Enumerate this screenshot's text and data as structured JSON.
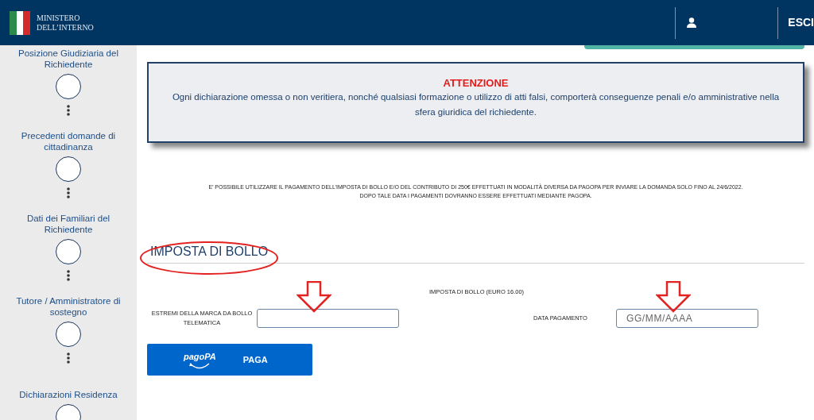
{
  "header": {
    "logo_lines": [
      "MINISTERO",
      "DELL’INTERNO"
    ],
    "logout": "ESCI"
  },
  "sidebar": {
    "steps": [
      {
        "label": "Posizione Giudiziaria del Richiedente"
      },
      {
        "label": "Precedenti domande di cittadinanza"
      },
      {
        "label": "Dati dei Familiari del Richiedente"
      },
      {
        "label": "Tutore / Amministratore di sostegno"
      },
      {
        "label": "Dichiarazioni Residenza"
      }
    ]
  },
  "alert": {
    "title": "ATTENZIONE",
    "text": "Ogni dichiarazione omessa o non veritiera, nonché qualsiasi formazione o utilizzo di atti falsi, comporterà conseguenze penali e/o amministrative nella sfera giuridica del richiedente."
  },
  "notice": [
    "E’ POSSIBILE UTILIZZARE IL PAGAMENTO DELL’IMPOSTA DI BOLLO E/O DEL CONTRIBUTO DI 250€ EFFETTUATI IN MODALITÀ DIVERSA DA PAGOPA PER INVIARE LA DOMANDA SOLO FINO AL 24/6/2022.",
    "DOPO TALE DATA I PAGAMENTI DOVRANNO ESSERE EFFETTUATI MEDIANTE PAGOPA."
  ],
  "section": {
    "title": "IMPOSTA DI BOLLO",
    "subtitle": "IMPOSTA DI BOLLO (EURO 16.00)",
    "fields": [
      {
        "label": "ESTREMI DELLA MARCA DA BOLLO TELEMATICA"
      },
      {
        "label": "DATA PAGAMENTO",
        "placeholder": "GG/MM/AAAA"
      }
    ],
    "pay_button": {
      "logo": "pagoPA",
      "label": "PAGA"
    }
  }
}
